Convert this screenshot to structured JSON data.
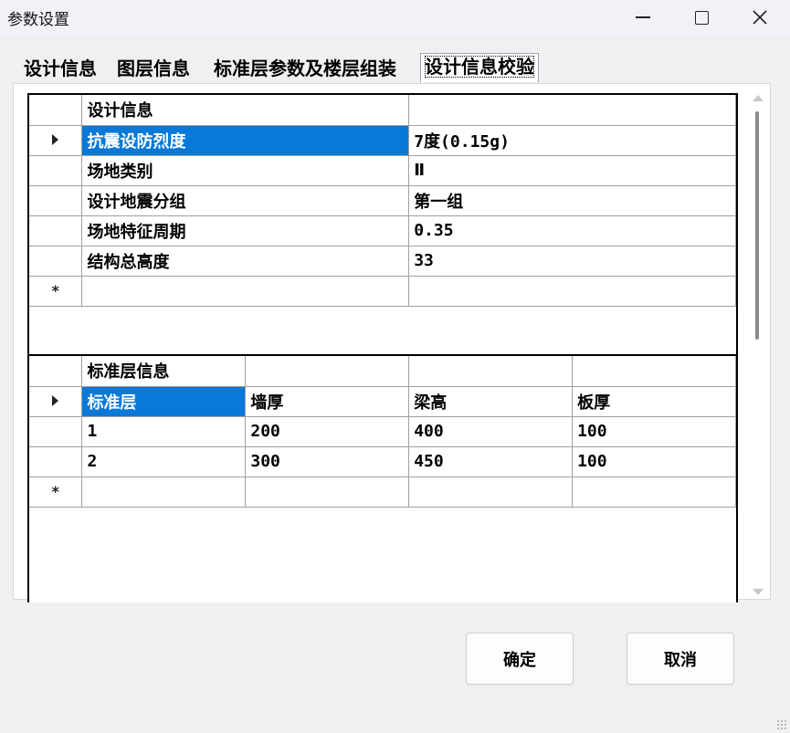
{
  "window": {
    "title": "参数设置",
    "minimize_icon": "minimize-icon",
    "maximize_icon": "maximize-icon",
    "close_icon": "close-icon"
  },
  "tabs": [
    {
      "label": "设计信息"
    },
    {
      "label": "图层信息"
    },
    {
      "label": "标准层参数及楼层组装"
    },
    {
      "label": "设计信息校验",
      "active": true
    }
  ],
  "design_grid": {
    "header": "设计信息",
    "rows": [
      {
        "name": "抗震设防烈度",
        "value": "7度(0.15g)"
      },
      {
        "name": "场地类别",
        "value": "Ⅱ"
      },
      {
        "name": "设计地震分组",
        "value": "第一组"
      },
      {
        "name": "场地特征周期",
        "value": "0.35"
      },
      {
        "name": "结构总高度",
        "value": "33"
      }
    ],
    "new_row_marker": "*"
  },
  "standard_grid": {
    "header": "标准层信息",
    "columns": [
      "标准层",
      "墙厚",
      "梁高",
      "板厚"
    ],
    "rows": [
      [
        "1",
        "200",
        "400",
        "100"
      ],
      [
        "2",
        "300",
        "450",
        "100"
      ]
    ],
    "new_row_marker": "*"
  },
  "buttons": {
    "ok": "确定",
    "cancel": "取消"
  },
  "colors": {
    "selection": "#0a78d7",
    "grid_border": "#000000",
    "cell_border": "#a0a0a0"
  }
}
